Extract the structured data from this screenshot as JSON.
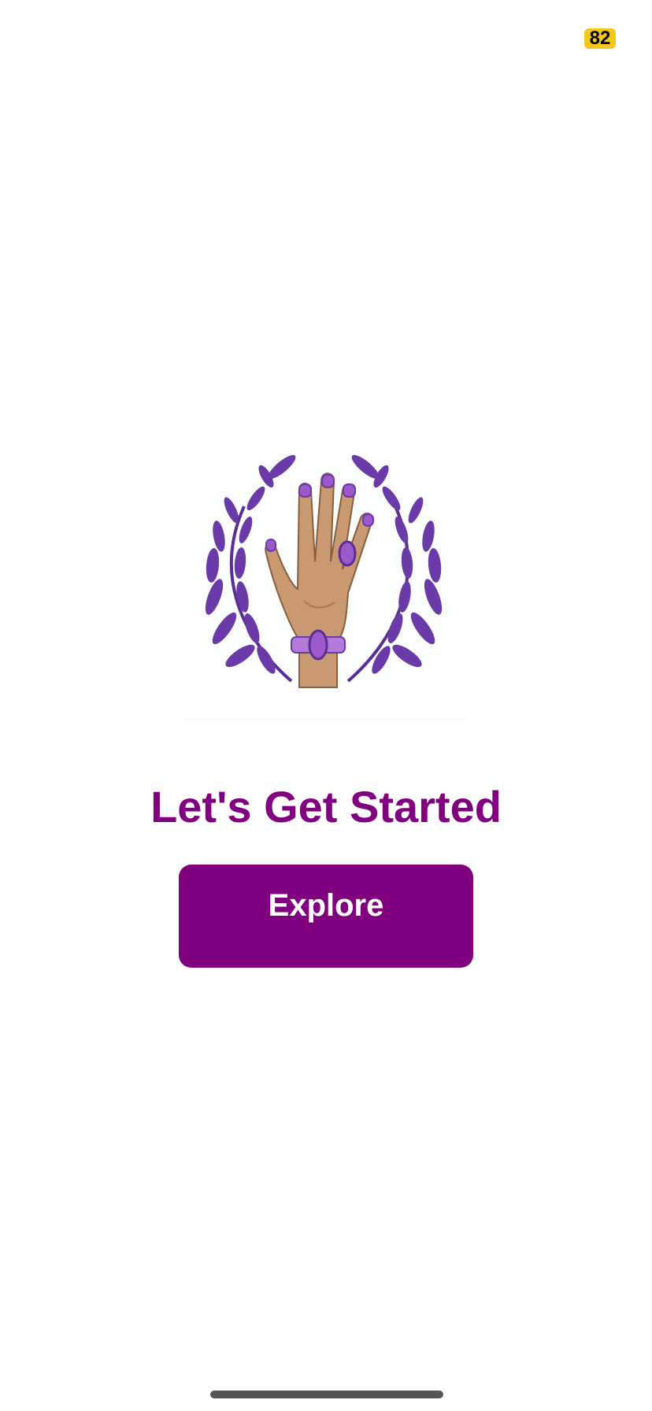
{
  "status": {
    "battery_level": "82",
    "battery_color": "#f2c81b"
  },
  "hero": {
    "icon": "hand-with-laurel-icon",
    "accent_color": "#6a3aa8"
  },
  "main": {
    "title": "Let's Get Started",
    "explore_label": "Explore"
  },
  "colors": {
    "brand": "#800080",
    "background": "#ffffff"
  }
}
